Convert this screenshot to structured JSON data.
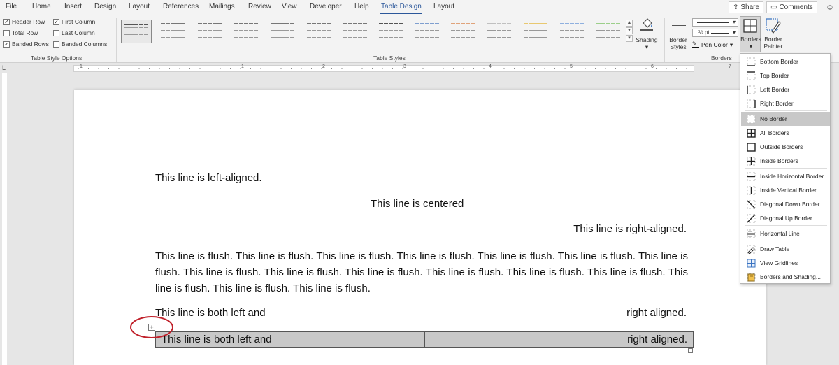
{
  "menu": {
    "tabs": [
      "File",
      "Home",
      "Insert",
      "Design",
      "Layout",
      "References",
      "Mailings",
      "Review",
      "View",
      "Developer",
      "Help",
      "Table Design",
      "Layout"
    ],
    "active_tab": "Table Design",
    "share_label": "Share",
    "comments_label": "Comments"
  },
  "ribbon": {
    "options": {
      "header_row": "Header Row",
      "first_column": "First Column",
      "total_row": "Total Row",
      "last_column": "Last Column",
      "banded_rows": "Banded Rows",
      "banded_columns": "Banded Columns",
      "group_label": "Table Style Options"
    },
    "styles_group_label": "Table Styles",
    "shading_label": "Shading",
    "border_styles_label": "Border Styles",
    "pen_weight": "½ pt",
    "pen_color_label": "Pen Color",
    "borders_label": "Borders",
    "border_painter_label": "Border Painter",
    "borders_group_label": "Borders"
  },
  "ruler": {
    "numbers": [
      "1",
      "1",
      "2",
      "3",
      "4",
      "5",
      "6",
      "7"
    ]
  },
  "document": {
    "left_line": "This line is left-aligned.",
    "center_line": "This line is centered",
    "right_line": "This line is right-aligned.",
    "flush_paragraph": "This line is flush. This line is flush. This line is flush. This line is flush. This line is flush. This line is flush. This line is flush. This line is flush. This line is flush. This line is flush. This line is flush. This line is flush. This line is flush. This line is flush. This line is flush. This line is flush.",
    "both_left": "This line is both left and",
    "both_right": "right aligned.",
    "table": {
      "left_cell": "This line is both left and",
      "right_cell": "right aligned."
    }
  },
  "borders_menu": {
    "items": [
      "Bottom Border",
      "Top Border",
      "Left Border",
      "Right Border",
      "No Border",
      "All Borders",
      "Outside Borders",
      "Inside Borders",
      "Inside Horizontal Border",
      "Inside Vertical Border",
      "Diagonal Down Border",
      "Diagonal Up Border",
      "Horizontal Line",
      "Draw Table",
      "View Gridlines",
      "Borders and Shading..."
    ],
    "highlighted": "No Border"
  },
  "colors": {
    "accent": "#2b579a",
    "annotation": "#c0202a",
    "table_fill": "#c8c8c8"
  }
}
